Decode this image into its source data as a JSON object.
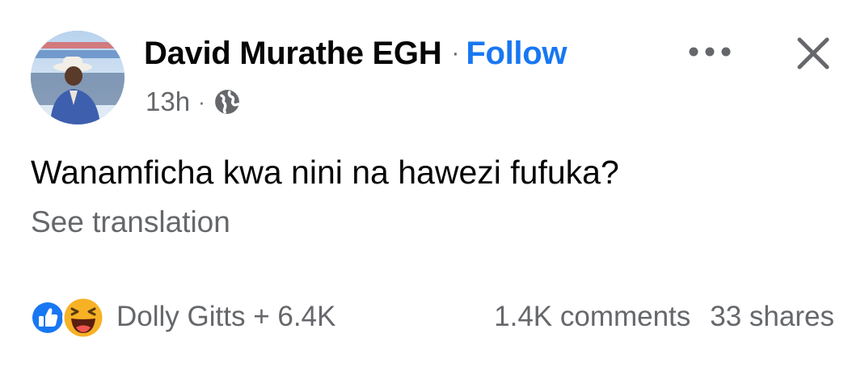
{
  "post": {
    "author_name": "David Murathe EGH",
    "separator": "·",
    "follow_label": "Follow",
    "timestamp": "13h",
    "meta_separator": "·",
    "privacy_icon": "globe-icon",
    "text": "Wanamficha kwa nini na hawezi fufuka?",
    "see_translation": "See translation"
  },
  "actions": {
    "more_icon": "more-horizontal-icon",
    "close_icon": "close-icon"
  },
  "reactions": {
    "icons": [
      "like-icon",
      "haha-icon"
    ],
    "summary": "Dolly Gitts + 6.4K"
  },
  "stats": {
    "comments": "1.4K comments",
    "shares": "33 shares"
  },
  "colors": {
    "link_blue": "#1877f2",
    "secondary_text": "#65676b",
    "primary_text": "#050505",
    "like_blue": "#1877f2",
    "haha_yellow": "#f7b125"
  }
}
